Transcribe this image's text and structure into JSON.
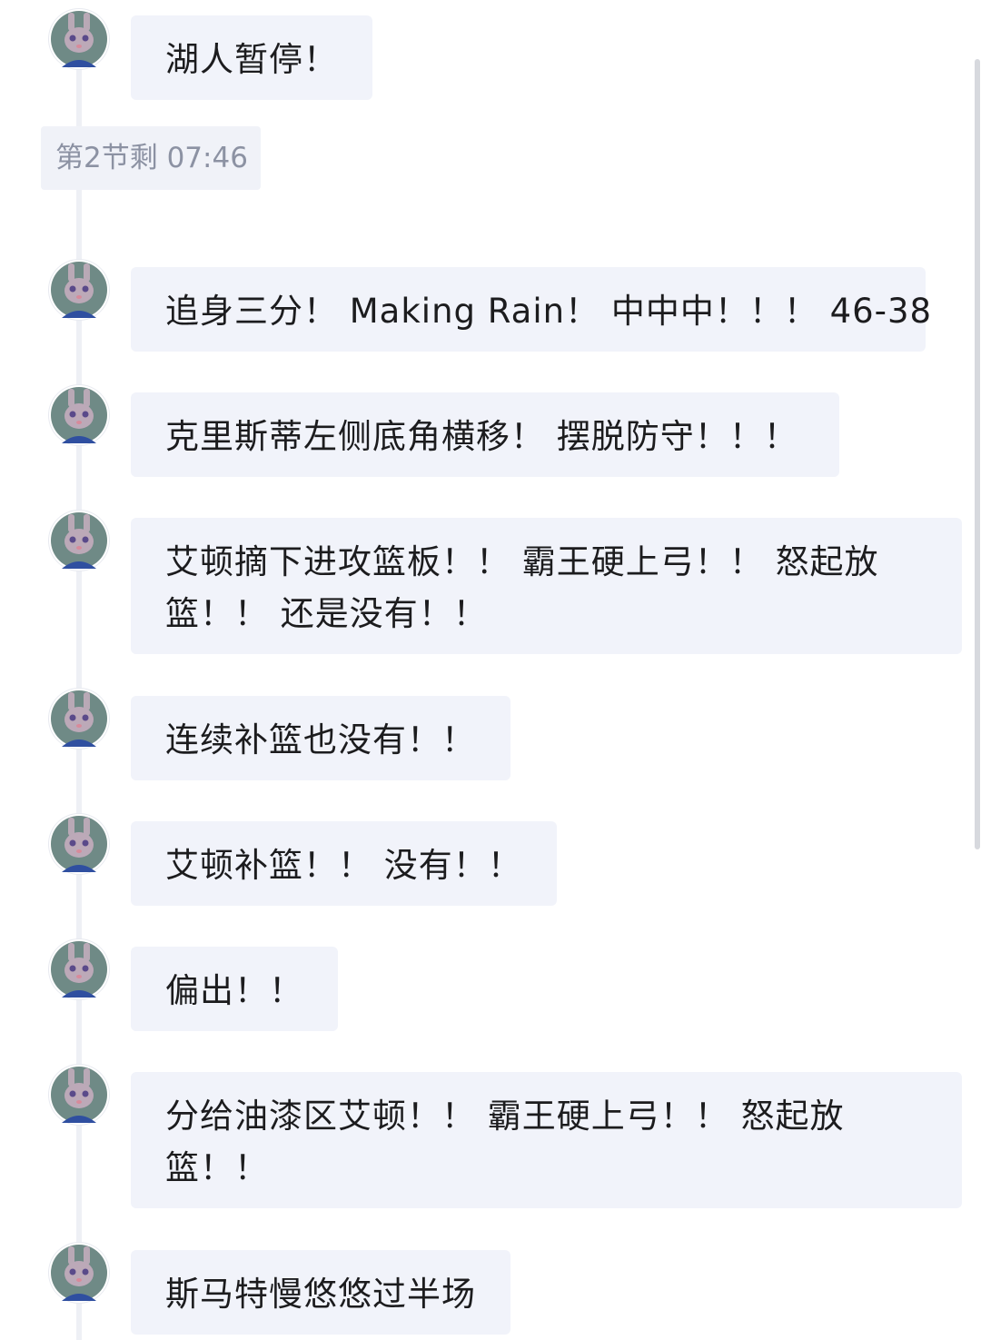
{
  "time_marker": "第2节剩 07:46",
  "messages": [
    {
      "text": "湖人暂停！"
    },
    {
      "text": "追身三分！ Making Rain！ 中中中！！！ 46-38"
    },
    {
      "text": "克里斯蒂左侧底角横移！ 摆脱防守！！！"
    },
    {
      "text": "艾顿摘下进攻篮板！！ 霸王硬上弓！！ 怒起放篮！！ 还是没有！！"
    },
    {
      "text": "连续补篮也没有！！"
    },
    {
      "text": "艾顿补篮！！ 没有！！"
    },
    {
      "text": "偏出！！"
    },
    {
      "text": "分给油漆区艾顿！！ 霸王硬上弓！！ 怒起放篮！！"
    },
    {
      "text": "斯马特慢悠悠过半场"
    }
  ],
  "icons": {
    "avatar": "cartoon-bunny-avatar-icon"
  },
  "colors": {
    "bubble_background": "#f1f3fa",
    "timeline": "#eef0f5",
    "time_text": "#8c92a3",
    "message_text": "#1c1c1e"
  }
}
